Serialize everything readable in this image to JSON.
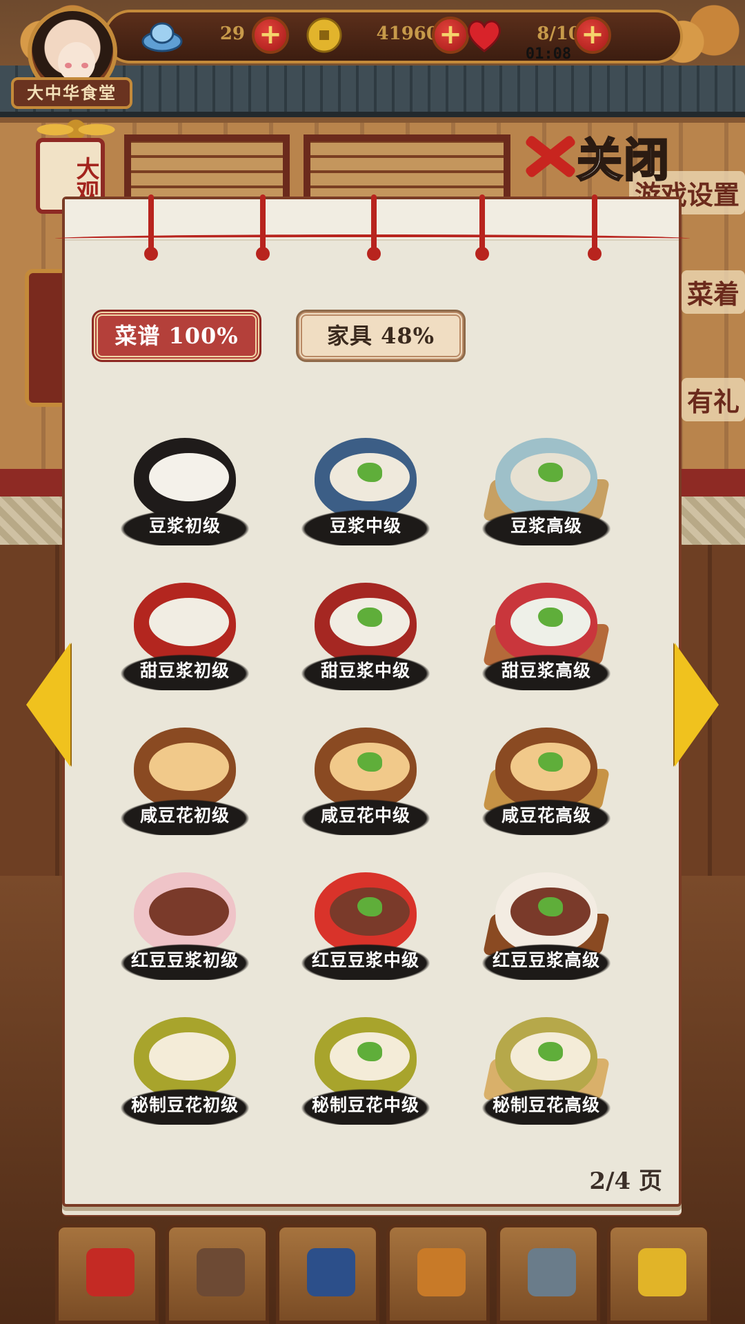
{
  "hud": {
    "ingot": {
      "icon": "silver-ingot-icon",
      "value": "29"
    },
    "coin": {
      "icon": "gold-coin-icon",
      "value": "41960"
    },
    "stamina": {
      "icon": "heart-icon",
      "value": "8/10",
      "timer": "01:08"
    },
    "plus_glyph": "+"
  },
  "restaurant": {
    "name": "大中华食堂",
    "side_tab": "大观"
  },
  "background_hints": [
    "游戏设置",
    "菜着",
    "有礼"
  ],
  "close_button": {
    "label": "关闭"
  },
  "tabs": [
    {
      "label": "菜谱 100%",
      "active": true
    },
    {
      "label": "家具 48%",
      "active": false
    }
  ],
  "dishes": [
    {
      "name": "豆浆初级",
      "bowl": "#1f1b1a",
      "liquid": "#f4f1ea",
      "plate": "none"
    },
    {
      "name": "豆浆中级",
      "bowl": "#3c5e86",
      "liquid": "#efe9dc",
      "plate": "none"
    },
    {
      "name": "豆浆高级",
      "bowl": "#9ec0c9",
      "liquid": "#e7e1d2",
      "plate": "#c7a062"
    },
    {
      "name": "甜豆浆初级",
      "bowl": "#b3261f",
      "liquid": "#f1ede3",
      "plate": "none"
    },
    {
      "name": "甜豆浆中级",
      "bowl": "#a52722",
      "liquid": "#f1ede3",
      "plate": "none"
    },
    {
      "name": "甜豆浆高级",
      "bowl": "#c9363c",
      "liquid": "#eef0e8",
      "plate": "#b56a3a"
    },
    {
      "name": "咸豆花初级",
      "bowl": "#8a4a22",
      "liquid": "#f1c98a",
      "plate": "none"
    },
    {
      "name": "咸豆花中级",
      "bowl": "#8a4a22",
      "liquid": "#f1c98a",
      "plate": "none"
    },
    {
      "name": "咸豆花高级",
      "bowl": "#8a4a22",
      "liquid": "#f1c98a",
      "plate": "#c79345"
    },
    {
      "name": "红豆豆浆初级",
      "bowl": "#efc4c8",
      "liquid": "#7a3a2a",
      "plate": "none"
    },
    {
      "name": "红豆豆浆中级",
      "bowl": "#d9332a",
      "liquid": "#7a3a2a",
      "plate": "none"
    },
    {
      "name": "红豆豆浆高级",
      "bowl": "#f3ece2",
      "liquid": "#7a3a2a",
      "plate": "#8a4a22"
    },
    {
      "name": "秘制豆花初级",
      "bowl": "#a8a42c",
      "liquid": "#f4ecd8",
      "plate": "none"
    },
    {
      "name": "秘制豆花中级",
      "bowl": "#a8a42c",
      "liquid": "#f4ecd8",
      "plate": "none"
    },
    {
      "name": "秘制豆花高级",
      "bowl": "#b6a84a",
      "liquid": "#f4ecd8",
      "plate": "#d9b06a"
    }
  ],
  "pagination": {
    "label": "2/4 页"
  },
  "bottom_nav": [
    {
      "icon": "treasure-box-icon",
      "color": "#c42a24"
    },
    {
      "icon": "hammer-icon",
      "color": "#6d4a34"
    },
    {
      "icon": "recipe-book-icon",
      "color": "#2c4f8a"
    },
    {
      "icon": "cooking-pot-icon",
      "color": "#c87a28"
    },
    {
      "icon": "chef-character-icon",
      "color": "#6a7c8a"
    },
    {
      "icon": "frying-wok-icon",
      "color": "#e1b428"
    }
  ]
}
